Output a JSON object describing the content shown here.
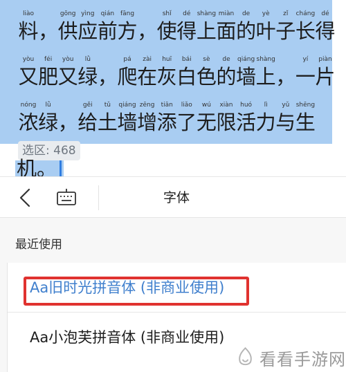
{
  "editor": {
    "lines": [
      [
        {
          "py": "liào",
          "hz": "料"
        },
        {
          "py": "",
          "hz": "，"
        },
        {
          "py": "gōng",
          "hz": "供"
        },
        {
          "py": "yìng",
          "hz": "应"
        },
        {
          "py": "qián",
          "hz": "前"
        },
        {
          "py": "fāng",
          "hz": "方"
        },
        {
          "py": "",
          "hz": "，"
        },
        {
          "py": "shǐ",
          "hz": "使"
        },
        {
          "py": "dé",
          "hz": "得"
        },
        {
          "py": "shàng",
          "hz": "上"
        },
        {
          "py": "miàn",
          "hz": "面"
        },
        {
          "py": "de",
          "hz": "的"
        },
        {
          "py": "yè",
          "hz": "叶"
        },
        {
          "py": "zǐ",
          "hz": "子"
        },
        {
          "py": "cháng",
          "hz": "长"
        },
        {
          "py": "dé",
          "hz": "得"
        }
      ],
      [
        {
          "py": "yòu",
          "hz": "又"
        },
        {
          "py": "féi",
          "hz": "肥"
        },
        {
          "py": "yòu",
          "hz": "又"
        },
        {
          "py": "lǜ",
          "hz": "绿"
        },
        {
          "py": "",
          "hz": "，"
        },
        {
          "py": "pá",
          "hz": "爬"
        },
        {
          "py": "zài",
          "hz": "在"
        },
        {
          "py": "huī",
          "hz": "灰"
        },
        {
          "py": "bái",
          "hz": "白"
        },
        {
          "py": "sè",
          "hz": "色"
        },
        {
          "py": "de",
          "hz": "的"
        },
        {
          "py": "qiáng",
          "hz": "墙"
        },
        {
          "py": "shàng",
          "hz": "上"
        },
        {
          "py": "",
          "hz": "，"
        },
        {
          "py": "yí",
          "hz": "一"
        },
        {
          "py": "piàn",
          "hz": "片"
        }
      ],
      [
        {
          "py": "nóng",
          "hz": "浓"
        },
        {
          "py": "lǜ",
          "hz": "绿"
        },
        {
          "py": "",
          "hz": "，"
        },
        {
          "py": "gěi",
          "hz": "给"
        },
        {
          "py": "tǔ",
          "hz": "土"
        },
        {
          "py": "qiáng",
          "hz": "墙"
        },
        {
          "py": "zēng",
          "hz": "增"
        },
        {
          "py": "tiān",
          "hz": "添"
        },
        {
          "py": "liǎo",
          "hz": "了"
        },
        {
          "py": "wú",
          "hz": "无"
        },
        {
          "py": "xiàn",
          "hz": "限"
        },
        {
          "py": "huó",
          "hz": "活"
        },
        {
          "py": "lì",
          "hz": "力"
        },
        {
          "py": "yǔ",
          "hz": "与"
        },
        {
          "py": "shēng",
          "hz": "生"
        }
      ]
    ],
    "last_line": "机。",
    "selection_label": "选区: 468"
  },
  "toolbar": {
    "back_icon": "chevron-left-icon",
    "keyboard_icon": "keyboard-icon",
    "title": "字体"
  },
  "panel": {
    "section_title": "最近使用",
    "fonts": [
      {
        "prefix": "Aa",
        "label": "旧时光拼音体 (非商业使用)",
        "active": true
      },
      {
        "prefix": "Aa",
        "label": "小泡芙拼音体 (非商业使用)",
        "active": false
      }
    ]
  },
  "colors": {
    "selection": "#a9cdf2",
    "accent": "#3f7fcd",
    "highlight_box": "#e0322f",
    "cursor": "#2f7de1"
  },
  "watermark": {
    "text": "看看手游网"
  }
}
